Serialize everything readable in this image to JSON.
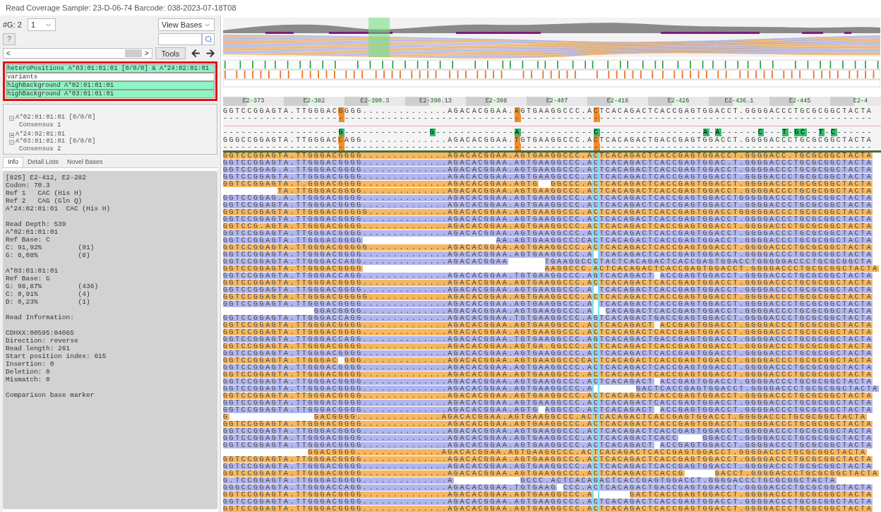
{
  "window": {
    "title": "Read Coverage Sample: 23-D-06-74 Barcode: 038-2023-07-18T08"
  },
  "controls": {
    "group_label": "#G: 2",
    "group_select": "1",
    "view_select": "View Bases",
    "help_button": "?",
    "scroll_left": "<",
    "scroll_right": ">",
    "tools_button": "Tools"
  },
  "position_list": [
    {
      "label": "heteroPositions A*03:01:01:01 [0/0/0] & A*24:02:01:01",
      "highlighted": true
    },
    {
      "label": "variants",
      "highlighted": false
    },
    {
      "label": "highBackground A*02:01:01:01",
      "highlighted": true
    },
    {
      "label": "highBackground A*03:01:01:01",
      "highlighted": true
    }
  ],
  "tree": [
    {
      "alleles": [
        {
          "label": "A*02:01:01:01 [0/0/0]",
          "expanded": false
        }
      ],
      "consensus": "Consensus 1"
    },
    {
      "alleles": [
        {
          "label": "A*24:02:01:01",
          "expanded": true
        },
        {
          "label": "A*03:01:01:01 [0/0/0]",
          "expanded": false
        }
      ],
      "consensus": "Consensus 2"
    }
  ],
  "tabs": [
    {
      "label": "Info",
      "selected": true
    },
    {
      "label": "Detail Lists",
      "selected": false
    },
    {
      "label": "Novel Bases",
      "selected": false
    }
  ],
  "info_blocks": [
    [
      "[825] E2-412, E2-282",
      "Codon: 70.3",
      "Ref 1   CAC (His H)",
      "Ref 2   CAG (Gln Q)",
      "A*24:02:01:01  CAC (His H)"
    ],
    [
      "Read Depth: 539",
      "A*02:01:01:01",
      "Ref Base: C",
      "C: 91,92%         (91)",
      "G: 8,08%          (8)"
    ],
    [
      "A*03:01:01:01",
      "Ref Base: G",
      "G: 98,87%         (436)",
      "C: 0,91%          (4)",
      "D: 0,23%          (1)"
    ],
    [
      "Read Information:"
    ],
    [
      "CDHXX:00595:04065",
      "Direction: reverse",
      "Read length: 261",
      "Start position index: 615",
      "Insertion: 0",
      "Deletion: 0",
      "Mismatch: 0"
    ],
    [
      "Comparison base marker"
    ]
  ],
  "ruler": [
    "E2-373",
    "E2-382",
    "E2-390.3",
    "E2-390.13",
    "E2-398",
    "E2-407",
    "E2-416",
    "E2-426",
    "E2-436.1",
    "E2-445",
    "E2-4"
  ],
  "consensus": [
    {
      "segments": [
        {
          "text": "GGTCCGGAGTA.TTGGGAC",
          "highlighted": false
        },
        {
          "text": "G",
          "highlighted": true
        },
        {
          "text": "GGG..............AGACACGGAA.",
          "highlighted": false
        },
        {
          "text": "A",
          "highlighted": true
        },
        {
          "text": "GTGAAGGCCC.A",
          "highlighted": false
        },
        {
          "text": "C",
          "highlighted": true
        },
        {
          "text": "TCACAGACTCACCGAGTGGACCT.GGGGACCCTGCGCGGCTACTA",
          "highlighted": false
        }
      ],
      "below": "-----------------------------------------------------------------------------------------------------------"
    },
    {
      "above": "-------------------G--------------G-------------A------------C-----------------A-A------C---T-GC--T-C------",
      "segments": [
        {
          "text": "GGGCCGGAGTA.TTGGGAC",
          "highlighted": false
        },
        {
          "text": "C",
          "highlighted": true
        },
        {
          "text": "AGG..............AGACACGGAA.",
          "highlighted": false
        },
        {
          "text": "T",
          "highlighted": true
        },
        {
          "text": "GTGAAGGCCC.A",
          "highlighted": false
        },
        {
          "text": "C",
          "highlighted": true
        },
        {
          "text": "TCACAGACTGACCGAGTGGACCT.GGGGACCCTGCGCGGCTACTA",
          "highlighted": false
        }
      ],
      "below": "-----------------------------------------------------------------------------------------------------------"
    }
  ],
  "reads": [
    {
      "color": "#f6b760",
      "seq": "GGTCCGGAGTA.TTGGGACGGGG..............AGACACGGAA.AGTGAAGGCCC.ACTCACAGACTCACCGAGTGGACCT.GGGGACC.TGCGCGGCTACTA"
    },
    {
      "color": "#b2b6ee",
      "seq": "GGTCCGGAGTA.TTGGGACGGGG..............AGACACGGAA.AGTGAAGGCCC.ACTCACAGACTCACCGAGTGGAC.T.GGGGACCCTGCGCGGCTACTA"
    },
    {
      "color": "#b2b6ee",
      "seq": "GGTCCGGAG.A.TTGGGACGGGG..............AGACACGGAA.AGTGAAGGCCC.ACTCACAGACTCACCGAGTGGACCT.GGGGACCCTGCGCGGCTACTA"
    },
    {
      "color": "#b2b6ee",
      "seq": "GGTCCGGAGTA.TTGGGACGGGG..............AGACACGGAA.AGTGAAGGCCC.ACTCACAGACTCACCGAGTGGACCT.GGGGACCCTGCGCGGCTACTA"
    },
    {
      "color": "#f6b760",
      "seq": "GGTCCGGAGTA.T.GGGACGGGG..............AGACACGGAA.AGTG  GGCCC.ACTCACAGACTCACCGAGTGGACCT.GGGGACCCTGCGCGGCTACTA"
    },
    {
      "color": "#f6b760",
      "seq": "         TA.TTGGGACGGGG..............AGACACGGAA.AGTGAAGGCCC.ACTCACAGACTCACCGAGTGGACCT.GGGGACCCTGCGCGGCTACTA"
    },
    {
      "color": "#b2b6ee",
      "seq": "GGTCCGGAG.A.TTGGGACGGGG..............AGACACGGAA.AGTGAAGGCCC.ACTCACAGACTCACCGAGTGGACCTGGGGGACCCTGCGCGGCTACTA"
    },
    {
      "color": "#b2b6ee",
      "seq": "GGTCCGGAGTA.TTGGGACGGGG..............AGACACGGAA.AGTGAAGGCCC.ACTCACAGACTCACCGAGTGGACCT.GGGGACCCTGCGCGGCTACTA"
    },
    {
      "color": "#f6b760",
      "seq": "GGTCCGGAGTA.TTGGGACGGGGG.............AGACACGGAA.AGTGAAGGCCC.ACTCACAGACTCACCGAGTGGACCTGGGGGACCCTGCGCGGCTACTA"
    },
    {
      "color": "#b2b6ee",
      "seq": "GGTCCGGAGTA.TTGGGACGGGG..............AGACACGGAA.AGTGAAGGCCC.ACTCACAGACTCACCGAGTGGACCT.GGGGACCCTGCGCGGCTACTA"
    },
    {
      "color": "#f6b760",
      "seq": "GGTCCG.AGTA.TTGGGACGGGG..............AGACACGGAA.AGTGAAGGCCC.ACTCACAGACTCACCGAGTGGACCT.GGGGACCCTGCGCGGCTACTA"
    },
    {
      "color": "#b2b6ee",
      "seq": "GGTCCGGAGTA.TTGGGACGGGG..............AGACACGGAA.AGTGAAGGCCC.ACTCACAGACTCACCGAGTGGACCT.GGGGACCCTGCGCGGCTACTA"
    },
    {
      "color": "#b2b6ee",
      "seq": "GGTCCGGAGTA.TTGGGACGGGG                      AA.AGTGAAGGCCCCACTCACAGACTCACCGAGTGGACCT.GGGGACCCTGCGCGGCTACTA"
    },
    {
      "color": "#f6b760",
      "seq": "GGTCCGGAGTA.TTGGGACGGGGG.............AGACACGGAA.AGTGAAGGCCC.ACTCACAGACTCACCGAGTGGACCT.GGGGACCCTGCGCGGCTACTA"
    },
    {
      "color": "#b2b6ee",
      "seq": "GGTCCGGAGTA.TTGGGACGGGG..............AGACACGGAA.AGTGAAGGCCC.A TCACAGACTCACCGAGTGGACCT.GGGGACCCTGCGCGGCTACTA"
    },
    {
      "color": "#b2b6ee",
      "seq": "GGTCCGGAGTA.TTGGGACCAGG..............AGACACGGAA      TGAAGGCCCTACTCACAGACTCACCGAGTGGACCTGGGGGACCCTGCGCGGCTA"
    },
    {
      "color": "#f6b760",
      "seq": "GGTCCGGAGTA.TTGGGACGGGG                              AAGGCCC.ACTCACAGACTCACCGAGTGGACCT.GGGGACCCTGCGCGGCTACTA"
    },
    {
      "color": "#b2b6ee",
      "seq": "GGTCCGGAGTA.TTGGGACCAGG..............AGACACGGAA.TGTGAAGGCCC.AGTCACAGACT ACCGAGTGGACCT.GGGGACCCTGCGCGGCTACTA"
    },
    {
      "color": "#f6b760",
      "seq": "GGTCCGGAGTA.TTGGGACGGGG..............AGACACGGAA.AGTGAAGGCCC.ACTCACAGACTCACCGAGTGGACCT.GGGGACCCTGCGCGGCTACTA"
    },
    {
      "color": "#b2b6ee",
      "seq": "GGTCCGGAGTA.TTGGGACGGGG..............AGACACGGAA.AGTGAAGGCCC.A TCACAGACTCACCGAGTGGACCT.GGGGACCCTGCGCGGCTACTA"
    },
    {
      "color": "#f6b760",
      "seq": "GGTCCGGAGTA.TTGGGACGGGGG.............AGACACGGAA.AGTGAAGGCCC.ACTCACAGACTCACCGAGTGGACCT.GGGGACCCTGCGCGGCTACTA"
    },
    {
      "color": "#b2b6ee",
      "seq": "GGTCCGGAGTA.TTGGGACGGGG..............AGACACGGAA.AGTGAAGGCCC.A TCACAGACTCACCGAGTGGACCT.GGGGACCCTGCGCGGCTACTA"
    },
    {
      "color": "#b2b6ee",
      "seq": "               GGACGGGG..............AGACACGGAA.AGTGAAGGCCC.A  CACAGACTCACCGAGTGGACCT.GGGGACCCTGCGCGGCTACTA"
    },
    {
      "color": "#b2b6ee",
      "seq": "GGTCCGGAGTA.TTGGGACCAGG..............AGACACGGAA.TGTGAAGGCCC.AGTCACAGACTGACCGAGTGGACCT.GGGGACCCTGCGCGGCTACTA"
    },
    {
      "color": "#f6b760",
      "seq": "GGTCCGGAGTA.TTGGGACGGGG..............AGACACGGAA.AGTGAAGGCCC.ACTCACAGACT ACCGAGTGGACCT.GGGGACCCTGCGCGGCTACTA"
    },
    {
      "color": "#f6b760",
      "seq": "GGTCCGGAGTA.TTGGGACGGGG..............AGACACGGAA.AGTGAAGGCCC.ACTCACAGACTCACCGAGTGGACCT.GGGGACCCTGCGCGGCTACTA"
    },
    {
      "color": "#b2b6ee",
      "seq": "GGTCCGGAGTA.TTGGGACCAGG..............AGACACGGAA.TGTGAAGGCCC.AGTCACAGACTGACCGAGTGGACCT.GGGGACCCTGCGCGGCTACTA"
    },
    {
      "color": "#f6b760",
      "seq": "GGTCCGGAGTA.TTGGGACGGGG..............AGACACGGAA.AGTGA.GGCCC.ACTCACAGACTCACCGAGTGGACCT.GGGGACCCTGCGCGGCTACTA"
    },
    {
      "color": "#b2b6ee",
      "seq": "GGTCCGGAGTA.TTGGGACGGGG..............AGACACGGAA.AGTGAAGGCCC.ACTCACAGACTCACCGAGTGGACCT.GGGGACCCTGCGCGGCTACTA"
    },
    {
      "color": "#f6b760",
      "seq": "GGTCCGGAGTA.TTGGGAC GGG..............AGACACGGAA.AGTGAAGGCCCCACTCACAGACTCACCGAGTGGACCT.GGGGACCCTGCGCGGCTACTA"
    },
    {
      "color": "#b2b6ee",
      "seq": "GGTCCGGAGTA.TTGGGACGGGG..............AGACACGGAA.AGTGAAGGCCC.ACTCACAGACTCACCGAGTGGACCT.GGGGACCCTGCGCGGCTACTA"
    },
    {
      "color": "#f6b760",
      "seq": "GGTCCGGAGTA.TTGGGACGGGG..............AGACACGGAA.AGTGAAGGCCC.ACTCACAGACTCACCGAGTGGACCT.GGGGACCCTGCGCGGCTACTA"
    },
    {
      "color": "#b2b6ee",
      "seq": "GGTCCGGAGTA.TTGGGACGGGG..............AGACACGGAA.AGTGAAGGCCC.ACTCACAGACT ACCGAGTGGACCT.GGGGACCCTGCGCGGCTACTA"
    },
    {
      "color": "#b2b6ee",
      "seq": "GGTCCGGAGTA.TTGGGACGGGG..............AGACACGGAA.AGTGAAGGCCC.A       GACTCACCGAGTGGACCT.GGGGACCCTGCGCGGCTACTA"
    },
    {
      "color": "#f6b760",
      "seq": "GGTCCGGAGTA.TTGGGACGGGG..............AGACACGGAA.AGTGAAGGCCC.ACTCACAGACTCACCGAGTGGACCT.GGGGACCCTGCGCGGCTACTA"
    },
    {
      "color": "#b2b6ee",
      "seq": "GGTCCGGAGTA.TTGGGACGGGG..............AGACACGGAA.AGTGAAGGCCC.ACTCACAGACTCACCGAGTGGACCT.GGGGACCCTGCGCGGCTACTA"
    },
    {
      "color": "#b2b6ee",
      "seq": "GGTCCGGAGTA.TTGGGACGGGG..............AGACACGGAA.AGTG AGGCCC.ACTCACAGACT ACCGAGTGGACCT.GGGGACCCTGCGCGGCTACTA"
    },
    {
      "color": "#f6b760",
      "seq": "G              GACGGGG..............AGACACGGAA.AGTGAAGGCCC.ACTCACAGACTCACCGAGTGGACCT.GGGGACCCTGCGCGGCTACTA"
    },
    {
      "color": "#f6b760",
      "seq": "GGTCCGGAGTA.TTGGGACGGGG..............AGACACGGAA.AGTGAAGGCCC.ACTCACAGACTCACCGAGTGGACCT.GGGGACCCTGCGCGGCTACTA"
    },
    {
      "color": "#b2b6ee",
      "seq": "GGTCCGGAGTA.TTGGGACGGGG..............AGACACGGAA.AGTGAAGGCCC.ACTCACAGACTCACCGAGTGGACCT.GGGGACCCTGCGCGGCTACTA"
    },
    {
      "color": "#b2b6ee",
      "seq": "GGTCCGGAGTA.TTGGGACGGGG..............AGACACGGAA.AGTGAAGGCCC.ACTCACAGACTCACC    GGACCT.GGGGACCCTGCGCGGCTACTA"
    },
    {
      "color": "#b2b6ee",
      "seq": "GGTCCGGAGTA.TTGGGACGGGG..............AGACACGGAA.AGTGAAGGCCC.ACTCACAGACT ACCGAGTGGACCT.GGGGACCCTGCGCGGCTACTA"
    },
    {
      "color": "#f6b760",
      "seq": "              GGACGGGG..............AGACACGGAA.AGTGAAGGCCC.ACTCACAGACTCACCGAGTGGACCT.GGGGACCCTGCGCGGCTACTA"
    },
    {
      "color": "#f6b760",
      "seq": "GGTCCGGAGTA.TTGGGACGGGG..............AGACACGGAA.AGTGAAGGCCC.ACTCACAGACTCACCGAGTGGACCT.GGGGACCCTGCGCGGCTACTA"
    },
    {
      "color": "#b2b6ee",
      "seq": "GGTCCGGAGTA.TTGGGACGGGG..............AGACACGGAA.AGTGAAGGCCC.ACTCACAGACTCACCGAGTGGACCT.GGGGACCCTGCGCGGCTACTA"
    },
    {
      "color": "#f6b760",
      "seq": "GGTCCGGAGTA.TTGGGACGGGG..............AGACACGGAA.AGTGAAGGCCC.ACTCACAGACTCACCG     GACCT.GGGGACCCTGCGCGGCTACTA"
    },
    {
      "color": "#b2b6ee",
      "seq": "G.TCCGGAGTA.TTGGGACGGGG..............A           GCCC.ACTCACAGACTCACCGAGTGGACCT.GGGGACCCTGCGCGGCTACTA"
    },
    {
      "color": "#b2b6ee",
      "seq": "GGGCCGGAGTA.TTGGGACCAGG..............AGACACGGAA.TGTGAAG CCC.ACTCACAGACTGACCGAGTGGACCT.GGGGACCCTGCGCGGCTACTA"
    },
    {
      "color": "#f6b760",
      "seq": "GGTCCGGAGTA.TTGGGACGGGG..............AGACACGGAA.AGTGAAGGCCC.A      GACTCACCGAGTGGACCT.GGGGACCCTGCGCGGCTACTA"
    },
    {
      "color": "#b2b6ee",
      "seq": "GGTCCGGAGTA.TTGGGACGGGG..............AGACACGGAA.AGTGAAGGCCC.ACTCACAGACTCACCGAGTGGACCT.GGGGACCCTGCGCGGCTACTA"
    },
    {
      "color": "#f6b760",
      "seq": "GGTCCGGAGTA.TTGGGACGGGG..............AGACACGGAA.AGTGAAGGCCC.ACTCACAGACTCACCGAGTGGACCT.GGGGACCCTGCGCGGCTACTA"
    }
  ]
}
